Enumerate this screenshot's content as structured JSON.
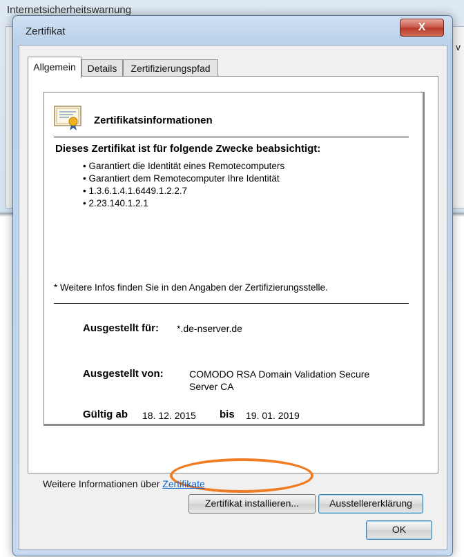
{
  "background_window": {
    "title": "Internetsicherheitswarnung",
    "edge_text": "v"
  },
  "dialog": {
    "title": "Zertifikat",
    "close_label": "X"
  },
  "tabs": [
    {
      "label": "Allgemein",
      "active": true
    },
    {
      "label": "Details",
      "active": false
    },
    {
      "label": "Zertifizierungspfad",
      "active": false
    }
  ],
  "info": {
    "heading": "Zertifikatsinformationen",
    "icon": "certificate-icon",
    "purpose_heading": "Dieses Zertifikat ist für folgende Zwecke beabsichtigt:",
    "purposes": [
      "Garantiert die Identität eines Remotecomputers",
      "Garantiert dem Remotecomputer Ihre Identität",
      "1.3.6.1.4.1.6449.1.2.2.7",
      "2.23.140.1.2.1"
    ],
    "note": "* Weitere Infos finden Sie in den Angaben der Zertifizierungsstelle.",
    "issued_to_label": "Ausgestellt für:",
    "issued_to_value": "*.de-nserver.de",
    "issued_by_label": "Ausgestellt von:",
    "issued_by_value_line1": "COMODO RSA Domain Validation Secure",
    "issued_by_value_line2": "Server CA",
    "valid_from_label": "Gültig ab",
    "valid_from_value": "18. 12. 2015",
    "valid_to_label": "bis",
    "valid_to_value": "19. 01. 2019"
  },
  "buttons": {
    "install": "Zertifikat installieren...",
    "issuer_statement": "Ausstellererklärung",
    "ok": "OK"
  },
  "more_info": {
    "text": "Weitere Informationen über",
    "link": "Zertifikate"
  },
  "colors": {
    "highlight": "#f07c24",
    "link": "#0d62c9"
  }
}
